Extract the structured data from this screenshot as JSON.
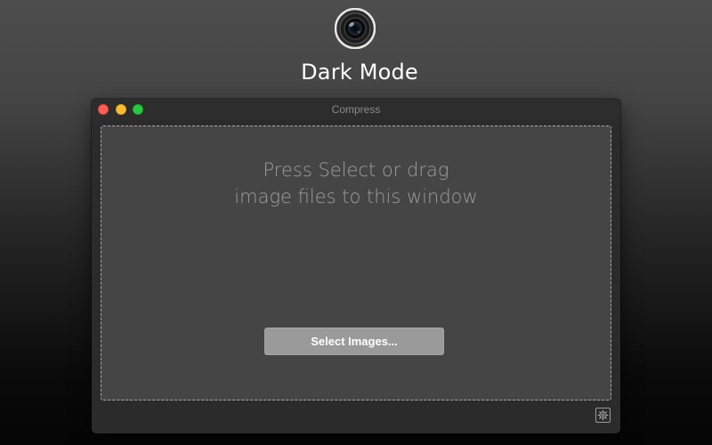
{
  "promo": {
    "title": "Dark Mode",
    "logo_icon": "camera-lens-icon"
  },
  "window": {
    "title": "Compress",
    "traffic_lights": {
      "close": "#fe5f57",
      "minimize": "#febc2e",
      "zoom": "#28c840"
    }
  },
  "drop_zone": {
    "line1": "Press Select or drag",
    "line2": "image files to this window",
    "select_button_label": "Select Images..."
  },
  "footer": {
    "settings_icon": "gear-icon"
  },
  "colors": {
    "window_bg": "#2b2b2b",
    "drop_zone_bg": "#454545",
    "button_bg": "#9a9a9a"
  }
}
